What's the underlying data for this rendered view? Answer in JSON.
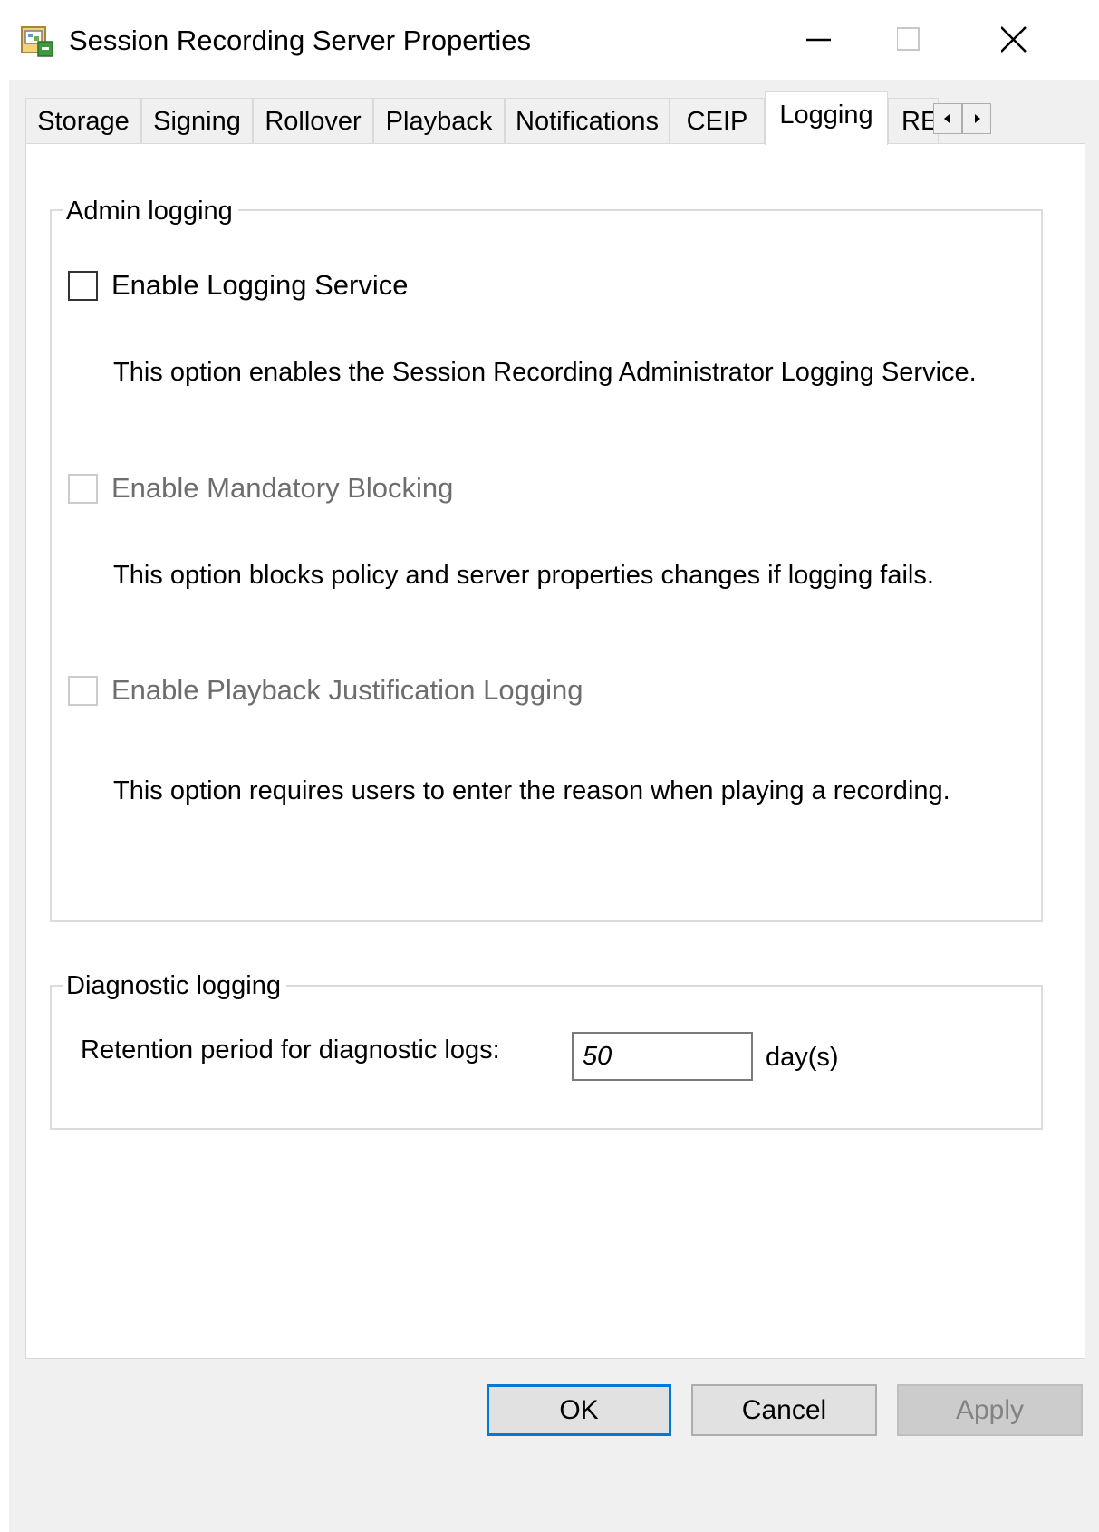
{
  "window": {
    "title": "Session Recording Server Properties"
  },
  "tabs": [
    {
      "label": "Storage"
    },
    {
      "label": "Signing"
    },
    {
      "label": "Rollover"
    },
    {
      "label": "Playback"
    },
    {
      "label": "Notifications"
    },
    {
      "label": "CEIP"
    },
    {
      "label": "Logging"
    },
    {
      "label": "RE"
    }
  ],
  "active_tab": "Logging",
  "admin_logging": {
    "legend": "Admin logging",
    "options": [
      {
        "label": "Enable Logging Service",
        "checked": false,
        "enabled": true,
        "description": "This option enables the Session Recording Administrator Logging Service."
      },
      {
        "label": "Enable Mandatory Blocking",
        "checked": false,
        "enabled": false,
        "description": "This option blocks policy and server properties changes if logging fails."
      },
      {
        "label": "Enable Playback Justification Logging",
        "checked": false,
        "enabled": false,
        "description": "This option requires users to enter the reason when playing a recording."
      }
    ]
  },
  "diagnostic_logging": {
    "legend": "Diagnostic logging",
    "retention_label": "Retention period for diagnostic logs:",
    "retention_value": "50",
    "unit": "day(s)"
  },
  "buttons": {
    "ok": "OK",
    "cancel": "Cancel",
    "apply": "Apply"
  },
  "colors": {
    "focus_accent": "#0078d7",
    "disabled_text": "#6d6d6d",
    "panel_bg": "#ffffff",
    "dialog_bg": "#f0f0f0"
  }
}
